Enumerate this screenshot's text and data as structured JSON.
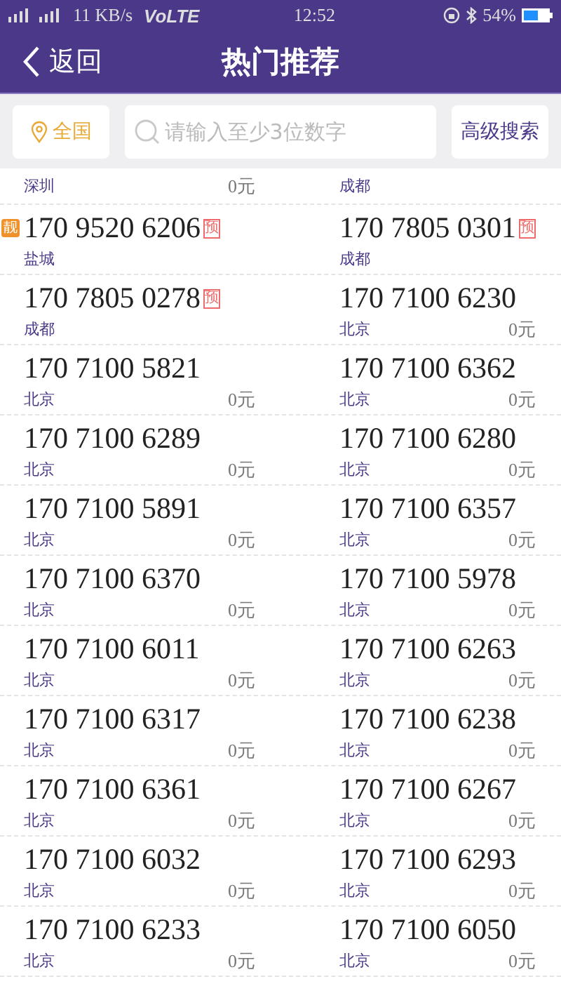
{
  "status_bar": {
    "network": "11 KB/s",
    "volte": "VoLTE",
    "time": "12:52",
    "battery": "54%"
  },
  "header": {
    "back": "返回",
    "title": "热门推荐"
  },
  "search": {
    "region": "全国",
    "placeholder": "请输入至少3位数字",
    "advanced": "高级搜索"
  },
  "top_cells": [
    {
      "city": "深圳",
      "price": "0元"
    },
    {
      "city": "成都"
    }
  ],
  "rows": [
    [
      {
        "number": "170 9520 6206",
        "featured": "靓",
        "reserved": "预",
        "city": "盐城"
      },
      {
        "number": "170 7805 0301",
        "reserved": "预",
        "city": "成都"
      }
    ],
    [
      {
        "number": "170 7805 0278",
        "reserved": "预",
        "city": "成都"
      },
      {
        "number": "170 7100 6230",
        "city": "北京",
        "price": "0元"
      }
    ],
    [
      {
        "number": "170 7100 5821",
        "city": "北京",
        "price": "0元"
      },
      {
        "number": "170 7100 6362",
        "city": "北京",
        "price": "0元"
      }
    ],
    [
      {
        "number": "170 7100 6289",
        "city": "北京",
        "price": "0元"
      },
      {
        "number": "170 7100 6280",
        "city": "北京",
        "price": "0元"
      }
    ],
    [
      {
        "number": "170 7100 5891",
        "city": "北京",
        "price": "0元"
      },
      {
        "number": "170 7100 6357",
        "city": "北京",
        "price": "0元"
      }
    ],
    [
      {
        "number": "170 7100 6370",
        "city": "北京",
        "price": "0元"
      },
      {
        "number": "170 7100 5978",
        "city": "北京",
        "price": "0元"
      }
    ],
    [
      {
        "number": "170 7100 6011",
        "city": "北京",
        "price": "0元"
      },
      {
        "number": "170 7100 6263",
        "city": "北京",
        "price": "0元"
      }
    ],
    [
      {
        "number": "170 7100 6317",
        "city": "北京",
        "price": "0元"
      },
      {
        "number": "170 7100 6238",
        "city": "北京",
        "price": "0元"
      }
    ],
    [
      {
        "number": "170 7100 6361",
        "city": "北京",
        "price": "0元"
      },
      {
        "number": "170 7100 6267",
        "city": "北京",
        "price": "0元"
      }
    ],
    [
      {
        "number": "170 7100 6032",
        "city": "北京",
        "price": "0元"
      },
      {
        "number": "170 7100 6293",
        "city": "北京",
        "price": "0元"
      }
    ],
    [
      {
        "number": "170 7100 6233",
        "city": "北京",
        "price": "0元"
      },
      {
        "number": "170 7100 6050",
        "city": "北京",
        "price": "0元"
      }
    ]
  ]
}
